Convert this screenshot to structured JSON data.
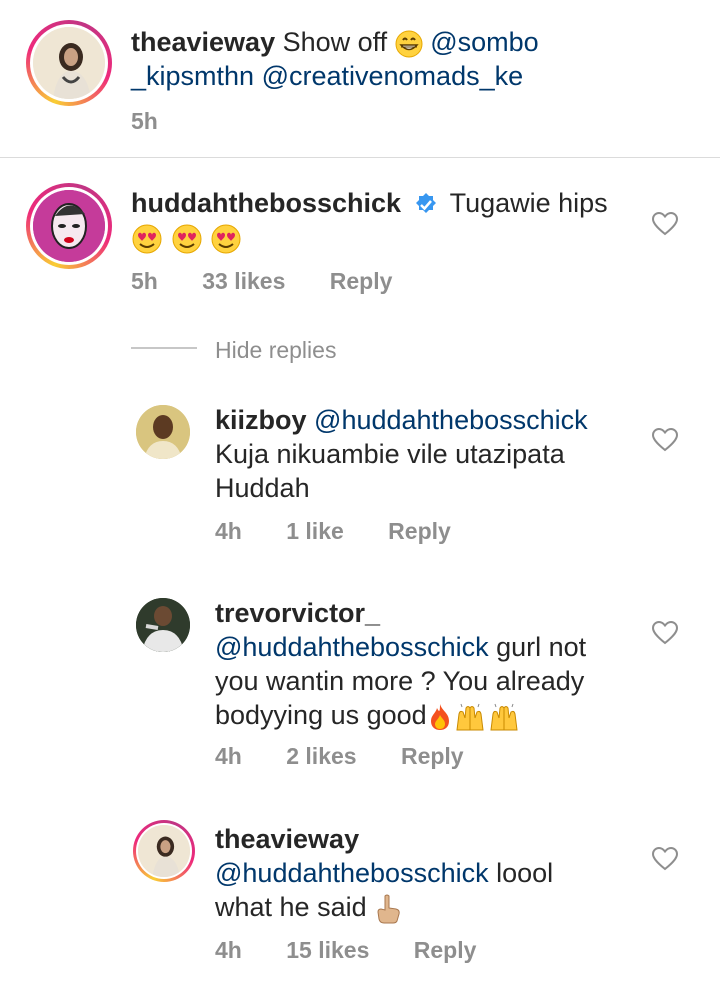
{
  "post_caption": {
    "username": "theavieway",
    "text": "Show off",
    "emoji": "grinning-face",
    "mentions_line1": "@sombo",
    "mentions_line2a": "_kipsmthn",
    "mentions_line2b": "@creativenomads_ke",
    "time": "5h"
  },
  "main_comment": {
    "username": "huddahthebosschick",
    "verified": true,
    "text": "Tugawie hips",
    "emojis": [
      "heart-eyes",
      "heart-eyes",
      "heart-eyes"
    ],
    "time": "5h",
    "likes": "33 likes",
    "reply": "Reply"
  },
  "hide_replies": "Hide replies",
  "replies": [
    {
      "username": "kiizboy",
      "mention": "@huddahthebosschick",
      "line2": "Kuja nikuambie vile utazipata",
      "line3": "Huddah",
      "time": "4h",
      "likes": "1 like",
      "reply": "Reply"
    },
    {
      "username": "trevorvictor_",
      "mention": "@huddahthebosschick",
      "text_after_mention": "gurl not",
      "line3": "you wantin more ? You already",
      "line4": "bodyying us good",
      "emojis": [
        "fire",
        "raised-hands",
        "raised-hands"
      ],
      "time": "4h",
      "likes": "2 likes",
      "reply": "Reply"
    },
    {
      "username": "theavieway",
      "mention": "@huddahthebosschick",
      "text_after_mention": "loool",
      "line3": "what he said",
      "emoji": "pointing-up-hand",
      "time": "4h",
      "likes": "15 likes",
      "reply": "Reply"
    }
  ],
  "colors": {
    "username": "#262626",
    "mention": "#00376b",
    "meta": "#8e8e8e",
    "verified": "#3897f0",
    "story_ring": "#ee2a7b"
  }
}
